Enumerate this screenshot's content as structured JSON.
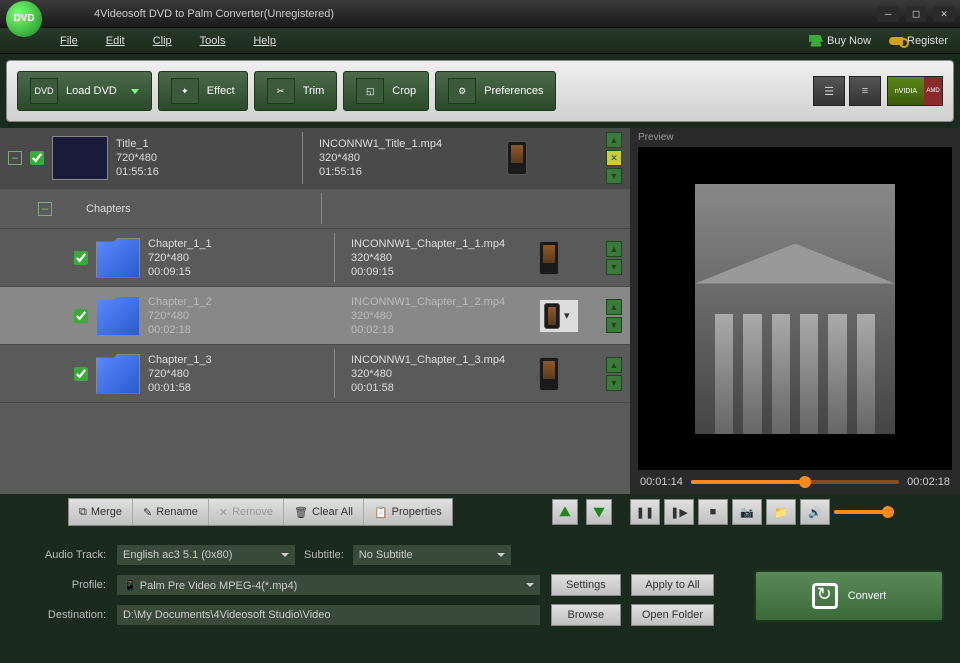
{
  "window": {
    "title": "4Videosoft DVD to Palm Converter(Unregistered)",
    "logo_text": "DVD"
  },
  "menu": {
    "file": "File",
    "edit": "Edit",
    "clip": "Clip",
    "tools": "Tools",
    "help": "Help",
    "buy_now": "Buy Now",
    "register": "Register"
  },
  "toolbar": {
    "load_dvd": "Load DVD",
    "effect": "Effect",
    "trim": "Trim",
    "crop": "Crop",
    "preferences": "Preferences",
    "nvidia": "nVIDIA",
    "amd": "AMD"
  },
  "list": {
    "title_item": {
      "name": "Title_1",
      "src_res": "720*480",
      "duration": "01:55:16",
      "out_name": "INCONNW1_Title_1.mp4",
      "out_res": "320*480",
      "out_duration": "01:55:16"
    },
    "chapters_label": "Chapters",
    "chapters": [
      {
        "name": "Chapter_1_1",
        "src_res": "720*480",
        "duration": "00:09:15",
        "out_name": "INCONNW1_Chapter_1_1.mp4",
        "out_res": "320*480",
        "out_duration": "00:09:15"
      },
      {
        "name": "Chapter_1_2",
        "src_res": "720*480",
        "duration": "00:02:18",
        "out_name": "INCONNW1_Chapter_1_2.mp4",
        "out_res": "320*480",
        "out_duration": "00:02:18"
      },
      {
        "name": "Chapter_1_3",
        "src_res": "720*480",
        "duration": "00:01:58",
        "out_name": "INCONNW1_Chapter_1_3.mp4",
        "out_res": "320*480",
        "out_duration": "00:01:58"
      }
    ]
  },
  "preview": {
    "label": "Preview",
    "current_time": "00:01:14",
    "total_time": "00:02:18"
  },
  "actions": {
    "merge": "Merge",
    "rename": "Rename",
    "remove": "Remove",
    "clear_all": "Clear All",
    "properties": "Properties"
  },
  "settings": {
    "audio_track_label": "Audio Track:",
    "audio_track_value": "English ac3 5.1 (0x80)",
    "subtitle_label": "Subtitle:",
    "subtitle_value": "No Subtitle",
    "profile_label": "Profile:",
    "profile_value": "Palm Pre Video MPEG-4(*.mp4)",
    "destination_label": "Destination:",
    "destination_value": "D:\\My Documents\\4Videosoft Studio\\Video",
    "settings_btn": "Settings",
    "apply_all_btn": "Apply to All",
    "browse_btn": "Browse",
    "open_folder_btn": "Open Folder"
  },
  "convert": {
    "label": "Convert"
  }
}
